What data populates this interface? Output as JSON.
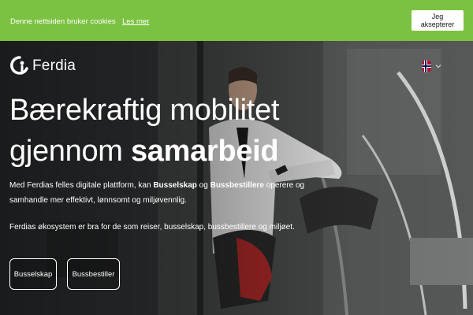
{
  "cookie_bar": {
    "text": "Denne nettsiden bruker cookies",
    "link": "Les mer",
    "accept": "Jeg aksepterer"
  },
  "header": {
    "brand": "Ferdia",
    "language_icon": "norway-flag-icon"
  },
  "hero": {
    "title_line1": "Bærekraftig mobilitet",
    "title_line2_regular": "gjennom ",
    "title_line2_bold": "samarbeid",
    "desc_part1": "Med Ferdias felles digitale plattform, kan ",
    "desc_bold1": "Busselskap",
    "desc_part2": " og ",
    "desc_bold2": "Bussbestillere",
    "desc_part3": " operere og samhandle mer effektivt, lønnsomt og miljøvennlig.",
    "ecosystem": "Ferdias økosystem er bra for de som reiser, busselskap, bussbestillere og miljøet.",
    "buttons": [
      "Busselskap",
      "Bussbestiller"
    ]
  },
  "colors": {
    "cookie_bar": "#7cc242",
    "text": "#ffffff"
  }
}
